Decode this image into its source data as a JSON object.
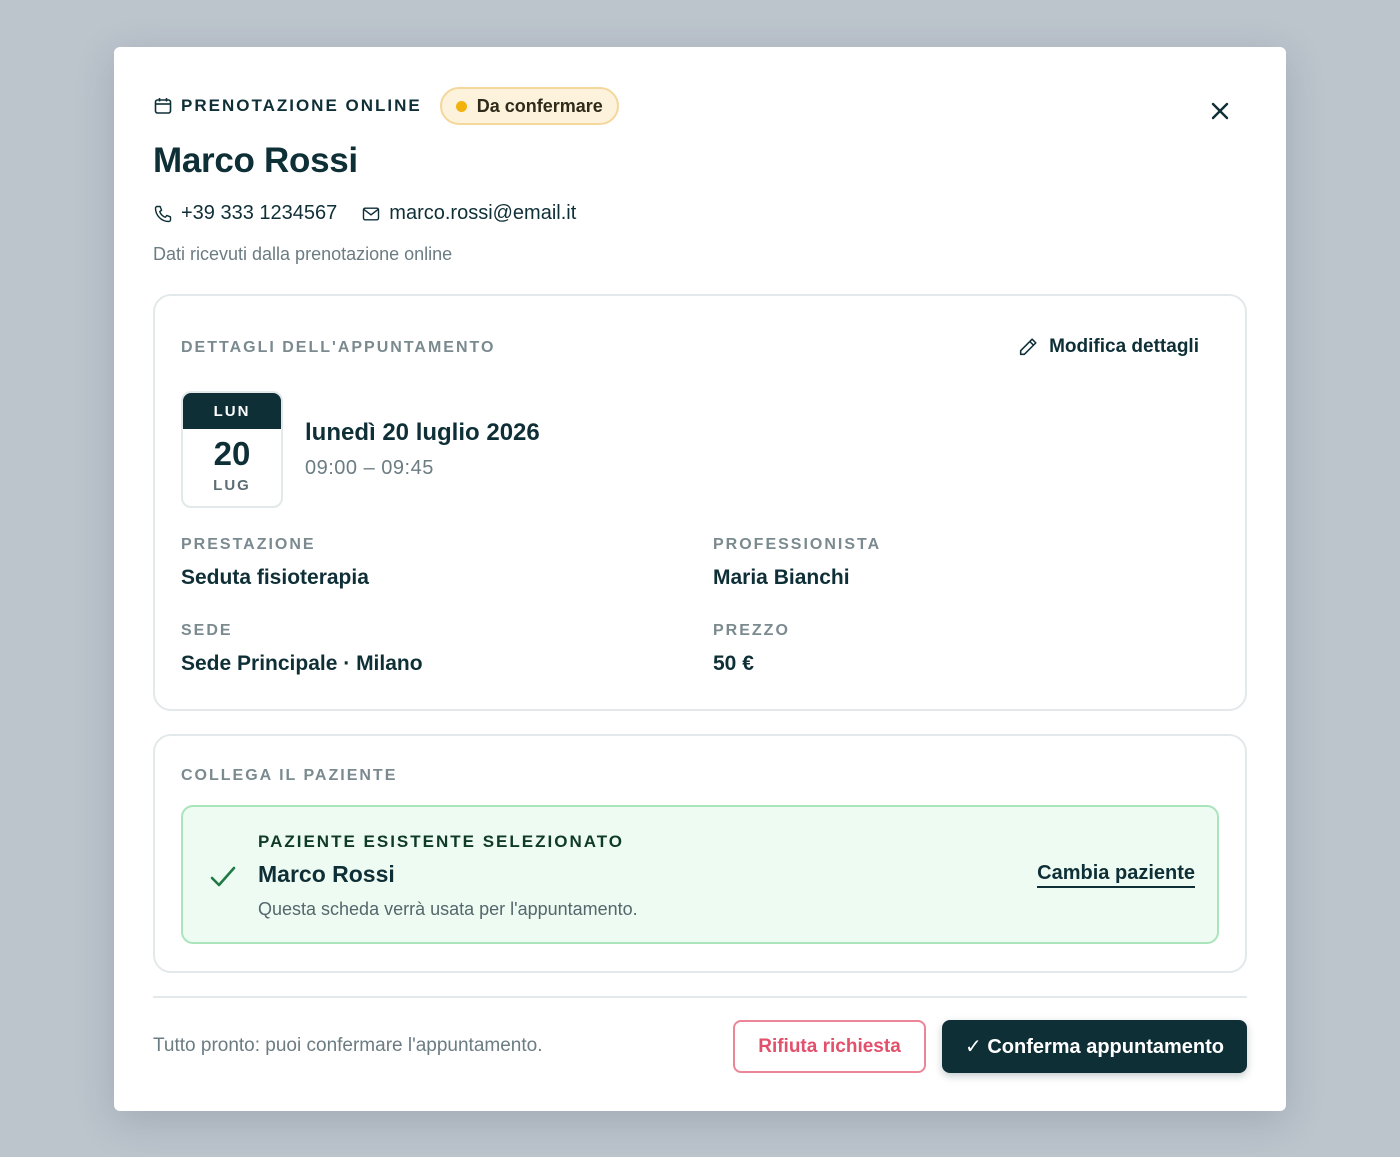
{
  "header": {
    "kicker": "PRENOTAZIONE ONLINE",
    "status_badge": "Da confermare",
    "status_color": "#f2b10d"
  },
  "patient": {
    "name": "Marco Rossi",
    "phone": "+39 333 1234567",
    "email": "marco.rossi@email.it",
    "source_note": "Dati ricevuti dalla prenotazione online"
  },
  "details": {
    "section_title": "DETTAGLI DELL'APPUNTAMENTO",
    "edit_label": "Modifica dettagli",
    "date": {
      "weekday_short": "LUN",
      "day": "20",
      "month_short": "LUG",
      "long": "lunedì 20 luglio 2026",
      "time_range": "09:00 – 09:45"
    },
    "fields": {
      "service_label": "PRESTAZIONE",
      "service_value": "Seduta fisioterapia",
      "professional_label": "PROFESSIONISTA",
      "professional_value": "Maria Bianchi",
      "location_label": "SEDE",
      "location_value": "Sede Principale · Milano",
      "price_label": "PREZZO",
      "price_value": "50 €"
    }
  },
  "link_patient": {
    "section_title": "COLLEGA IL PAZIENTE",
    "selected_kicker": "PAZIENTE ESISTENTE SELEZIONATO",
    "selected_name": "Marco Rossi",
    "selected_note": "Questa scheda verrà usata per l'appuntamento.",
    "change_label": "Cambia paziente"
  },
  "footer": {
    "note": "Tutto pronto: puoi confermare l'appuntamento.",
    "reject_label": "Rifiuta richiesta",
    "confirm_label": "✓ Conferma appuntamento"
  },
  "icons": {
    "header": "calendar-icon",
    "close": "close-icon",
    "phone": "phone-icon",
    "email": "mail-icon",
    "edit": "pencil-icon",
    "selected": "check-icon"
  }
}
